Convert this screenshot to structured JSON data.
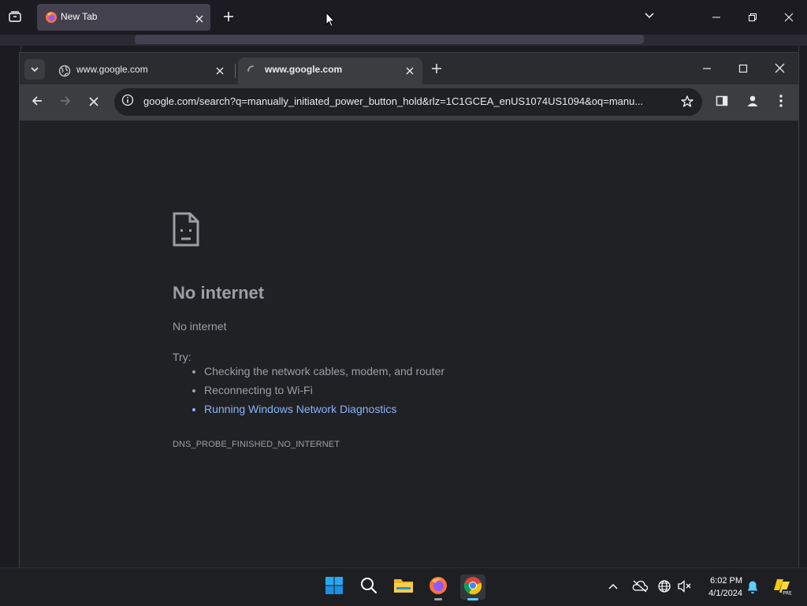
{
  "firefox": {
    "tab_title": "New Tab"
  },
  "chrome": {
    "tabs": [
      {
        "label": "www.google.com",
        "state": "inactive"
      },
      {
        "label": "www.google.com",
        "state": "active-loading"
      }
    ],
    "url": "google.com/search?q=manually_initiated_power_button_hold&rlz=1C1GCEA_enUS1074US1094&oq=manu..."
  },
  "error_page": {
    "title": "No internet",
    "description": "No internet",
    "try_label": "Try:",
    "suggestions": [
      "Checking the network cables, modem, and router",
      "Reconnecting to Wi-Fi",
      "Running Windows Network Diagnostics"
    ],
    "error_code": "DNS_PROBE_FINISHED_NO_INTERNET"
  },
  "taskbar": {
    "time": "6:02 PM",
    "date": "4/1/2024",
    "copilot_badge": "PRE"
  },
  "colors": {
    "link": "#8ab4f8",
    "taskbar_active_indicator": "#60cdff",
    "notification_bell": "#60cdff"
  }
}
